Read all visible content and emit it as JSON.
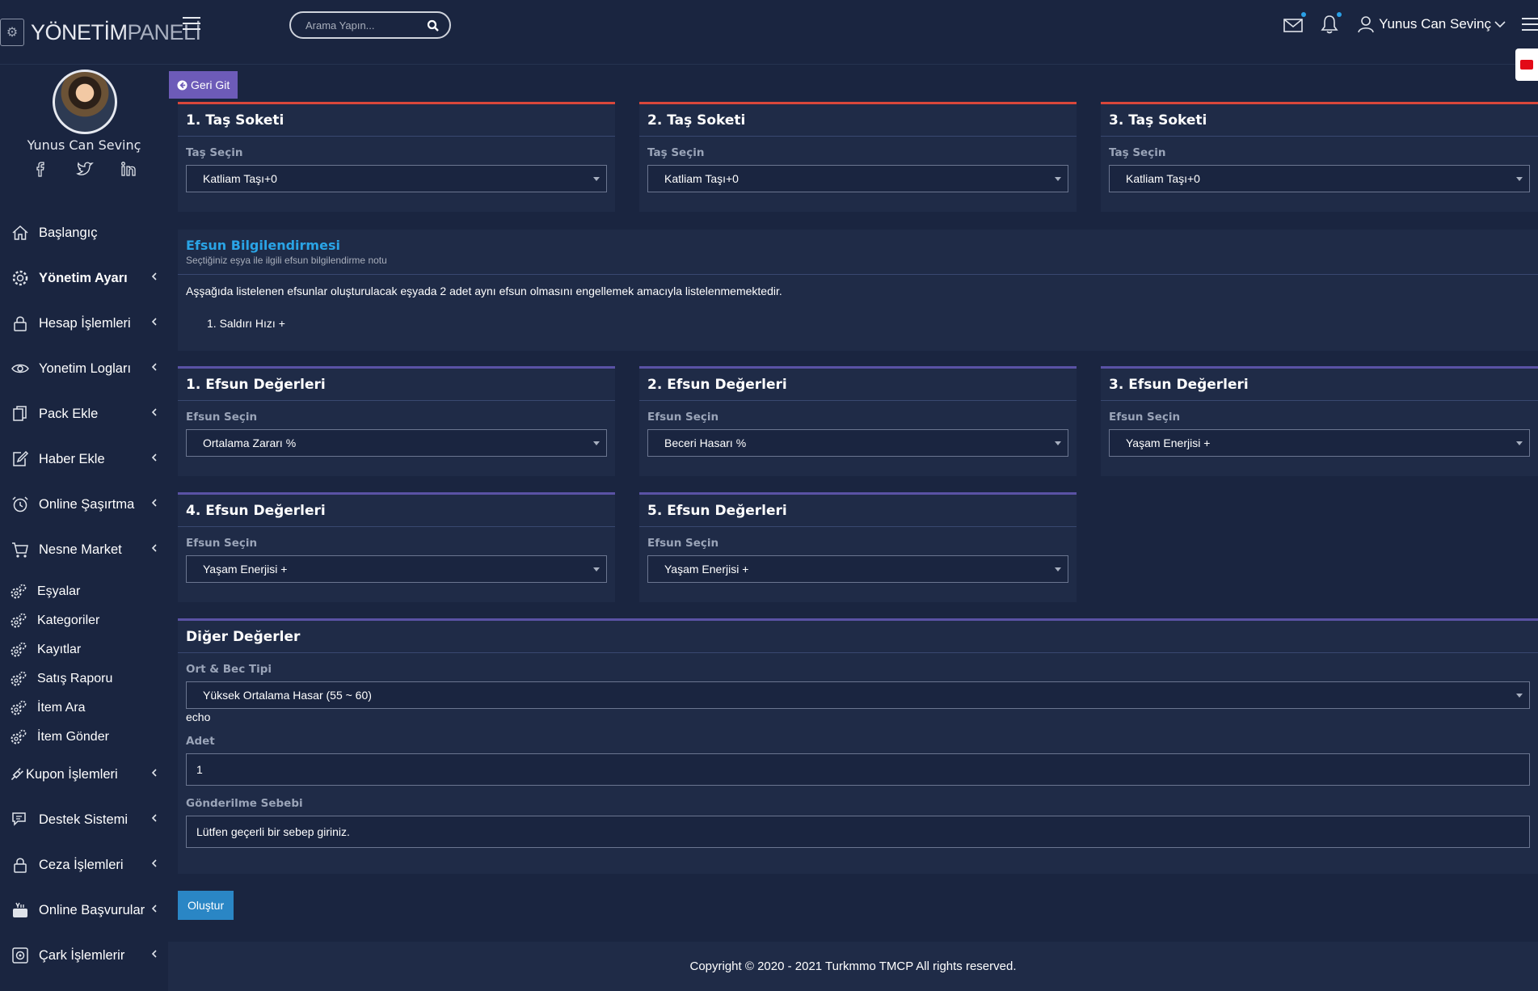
{
  "header": {
    "logo_part1": "YÖNETİM",
    "logo_part2": "PANELİ",
    "search_placeholder": "Arama Yapın...",
    "user_name": "Yunus Can Sevinç"
  },
  "sidebar": {
    "profile_name": "Yunus Can Sevinç",
    "items": [
      {
        "label": "Başlangıç",
        "icon": "home-icon",
        "chevron": false,
        "bold": false
      },
      {
        "label": "Yönetim Ayarı",
        "icon": "gear-icon",
        "chevron": true,
        "bold": true
      },
      {
        "label": "Hesap İşlemleri",
        "icon": "lock-icon",
        "chevron": true,
        "bold": false
      },
      {
        "label": "Yonetim Logları",
        "icon": "eye-icon",
        "chevron": true,
        "bold": false
      },
      {
        "label": "Pack Ekle",
        "icon": "copy-icon",
        "chevron": true,
        "bold": false
      },
      {
        "label": "Haber Ekle",
        "icon": "edit-icon",
        "chevron": true,
        "bold": false
      },
      {
        "label": "Online Şaşırtma",
        "icon": "alarm-icon",
        "chevron": true,
        "bold": false
      },
      {
        "label": "Nesne Market",
        "icon": "cart-icon",
        "chevron": true,
        "bold": false
      }
    ],
    "sub_items": [
      "Eşyalar",
      "Kategoriler",
      "Kayıtlar",
      "Satış Raporu",
      "İtem Ara",
      "İtem Gönder"
    ],
    "items_after": [
      {
        "label": "Kupon İşlemleri",
        "icon": "plug-icon"
      },
      {
        "label": "Destek Sistemi",
        "icon": "chat-icon"
      },
      {
        "label": "Ceza İşlemleri",
        "icon": "lock-icon"
      },
      {
        "label": "Online Başvurular",
        "icon": "youtube-icon"
      },
      {
        "label": "Çark İşlemlerir",
        "icon": "safe-icon"
      }
    ]
  },
  "main": {
    "back_label": "Geri Git",
    "stone_sockets": [
      {
        "title": "1. Taş Soketi",
        "label": "Taş Seçin",
        "value": "Katliam Taşı+0"
      },
      {
        "title": "2. Taş Soketi",
        "label": "Taş Seçin",
        "value": "Katliam Taşı+0"
      },
      {
        "title": "3. Taş Soketi",
        "label": "Taş Seçin",
        "value": "Katliam Taşı+0"
      }
    ],
    "info": {
      "title": "Efsun Bilgilendirmesi",
      "subtitle": "Seçtiğiniz eşya ile ilgili efsun bilgilendirme notu",
      "text": "Aşşağıda listelenen efsunlar oluşturulacak eşyada 2 adet aynı efsun olmasını engellemek amacıyla listelenmemektedir.",
      "list_item": "1. Saldırı Hızı +"
    },
    "bonuses": [
      {
        "title": "1. Efsun Değerleri",
        "label": "Efsun Seçin",
        "value": "Ortalama Zararı %"
      },
      {
        "title": "2. Efsun Değerleri",
        "label": "Efsun Seçin",
        "value": "Beceri Hasarı %"
      },
      {
        "title": "3. Efsun Değerleri",
        "label": "Efsun Seçin",
        "value": "Yaşam Enerjisi +"
      },
      {
        "title": "4. Efsun Değerleri",
        "label": "Efsun Seçin",
        "value": "Yaşam Enerjisi +"
      },
      {
        "title": "5. Efsun Değerleri",
        "label": "Efsun Seçin",
        "value": "Yaşam Enerjisi +"
      }
    ],
    "other": {
      "title": "Diğer Değerler",
      "type_label": "Ort & Bec Tipi",
      "type_value": "Yüksek Ortalama Hasar (55 ~ 60)",
      "echo": "echo",
      "qty_label": "Adet",
      "qty_value": "1",
      "reason_label": "Gönderilme Sebebi",
      "reason_value": "Lütfen geçerli bir sebep giriniz."
    },
    "submit_label": "Oluştur"
  },
  "footer": {
    "text": "Copyright © 2020 - 2021 Turkmmo TMCP All rights reserved."
  },
  "colors": {
    "background": "#1a2540",
    "card": "#1f2b47",
    "socket_accent": "#d9473b",
    "bonus_accent": "#5a52a5",
    "back_button": "#6d5bb8",
    "submit_button": "#2a86c5",
    "info_title": "#2aa4e6"
  }
}
